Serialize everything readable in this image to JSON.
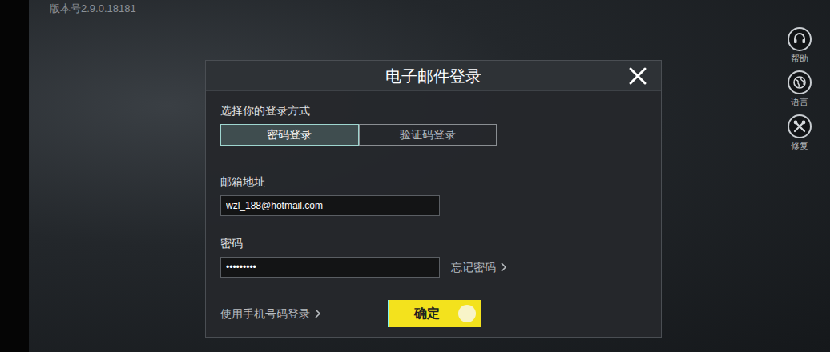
{
  "version": "版本号2.9.0.18181",
  "side_buttons": [
    {
      "label": "帮助"
    },
    {
      "label": "语言"
    },
    {
      "label": "修复"
    }
  ],
  "dialog": {
    "title": "电子邮件登录",
    "method_label": "选择你的登录方式",
    "methods": [
      {
        "label": "密码登录",
        "selected": true
      },
      {
        "label": "验证码登录",
        "selected": false
      }
    ],
    "email": {
      "label": "邮箱地址",
      "value": "wzl_188@hotmail.com"
    },
    "password": {
      "label": "密码",
      "value": "•••••••••"
    },
    "forgot": "忘记密码",
    "phone_login": "使用手机号码登录",
    "confirm": "确定"
  }
}
